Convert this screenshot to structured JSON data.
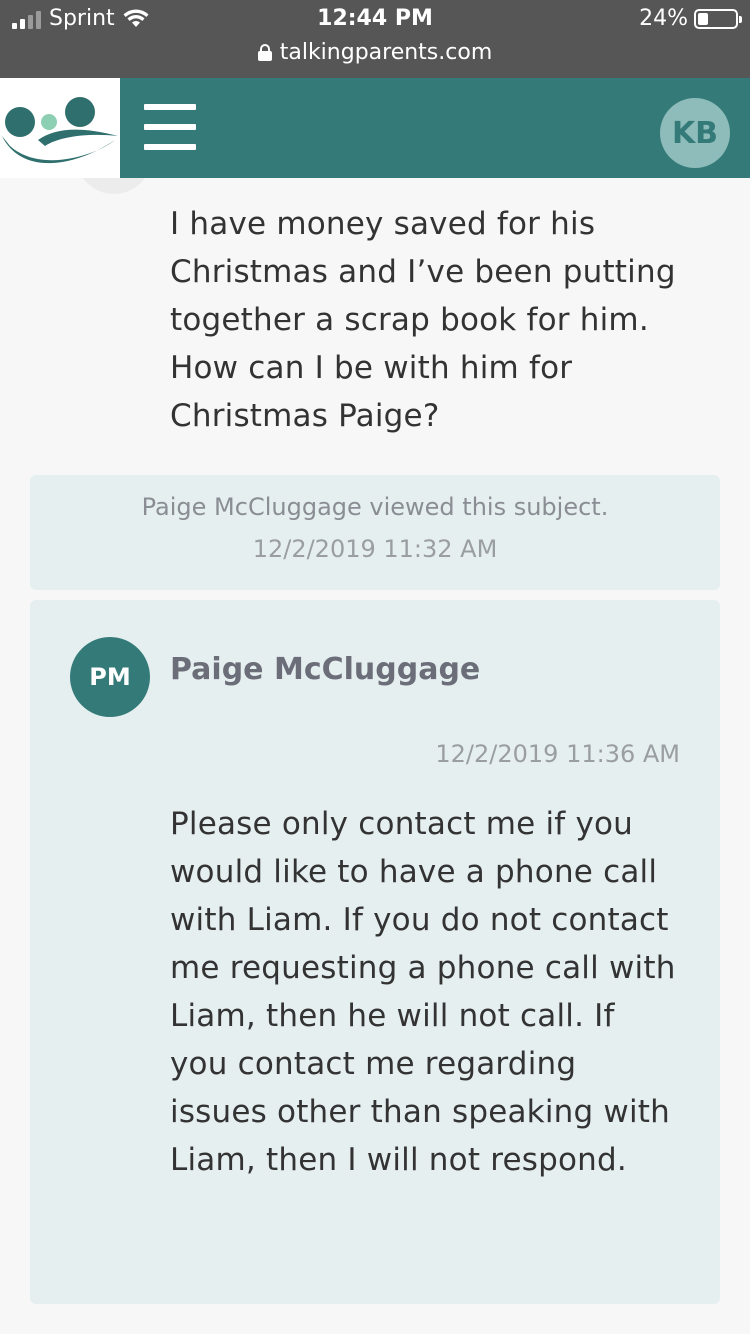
{
  "status_bar": {
    "carrier": "Sprint",
    "time": "12:44 PM",
    "battery_percent": "24%",
    "battery_level": 0.24,
    "url": "talkingparents.com"
  },
  "header": {
    "logo_icon": "talkingparents-logo",
    "menu_icon": "hamburger-menu-icon",
    "user_initials": "KB",
    "colors": {
      "brand": "#337a78",
      "avatar_light": "#8dbcba"
    }
  },
  "thread": {
    "previous_message_text": "I have money saved for his Christmas and I’ve been putting together a scrap book for him. How can I be with him for Christmas Paige?",
    "viewed_notice": {
      "text": "Paige McCluggage viewed this subject.",
      "date": "12/2/2019 11:32 AM"
    },
    "reply": {
      "avatar_initials": "PM",
      "sender": "Paige McCluggage",
      "date": "12/2/2019 11:36 AM",
      "text": "Please only contact me if you would like to have a phone call with Liam. If you do not contact me requesting a phone call with Liam, then he will not call. If you contact me regarding issues other than speaking with Liam, then I will not respond."
    }
  }
}
